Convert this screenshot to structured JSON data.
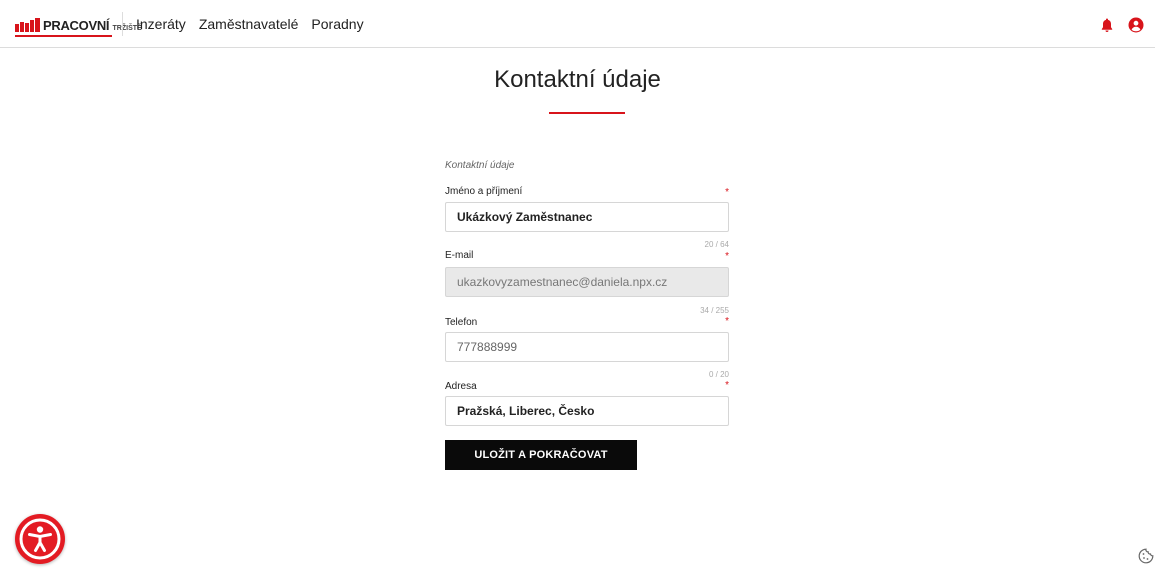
{
  "header": {
    "logo_text": "PRACOVNÍ",
    "logo_small": "TRŽIŠTĚ",
    "nav": [
      "Inzeráty",
      "Zaměstnavatelé",
      "Poradny"
    ],
    "icons": [
      "bell-icon",
      "user-icon"
    ]
  },
  "page": {
    "title": "Kontaktní údaje"
  },
  "form": {
    "section_label": "Kontaktní údaje",
    "required_mark": "*",
    "fields": [
      {
        "label": "Jméno a příjmení",
        "value": "Ukázkový Zaměstnanec",
        "counter": "20 / 64"
      },
      {
        "label": "E-mail",
        "value": "ukazkovyzamestnanec@daniela.npx.cz",
        "counter": "34 / 255"
      },
      {
        "label": "Telefon",
        "value": "",
        "placeholder": "777888999",
        "counter": "0 / 20"
      },
      {
        "label": "Adresa",
        "value": "Pražská, Liberec, Česko"
      }
    ],
    "submit_label": "ULOŽIT A POKRAČOVAT"
  },
  "colors": {
    "accent": "#d8141b",
    "button": "#0a0a0a",
    "disabled_bg": "#e9e9e9"
  }
}
